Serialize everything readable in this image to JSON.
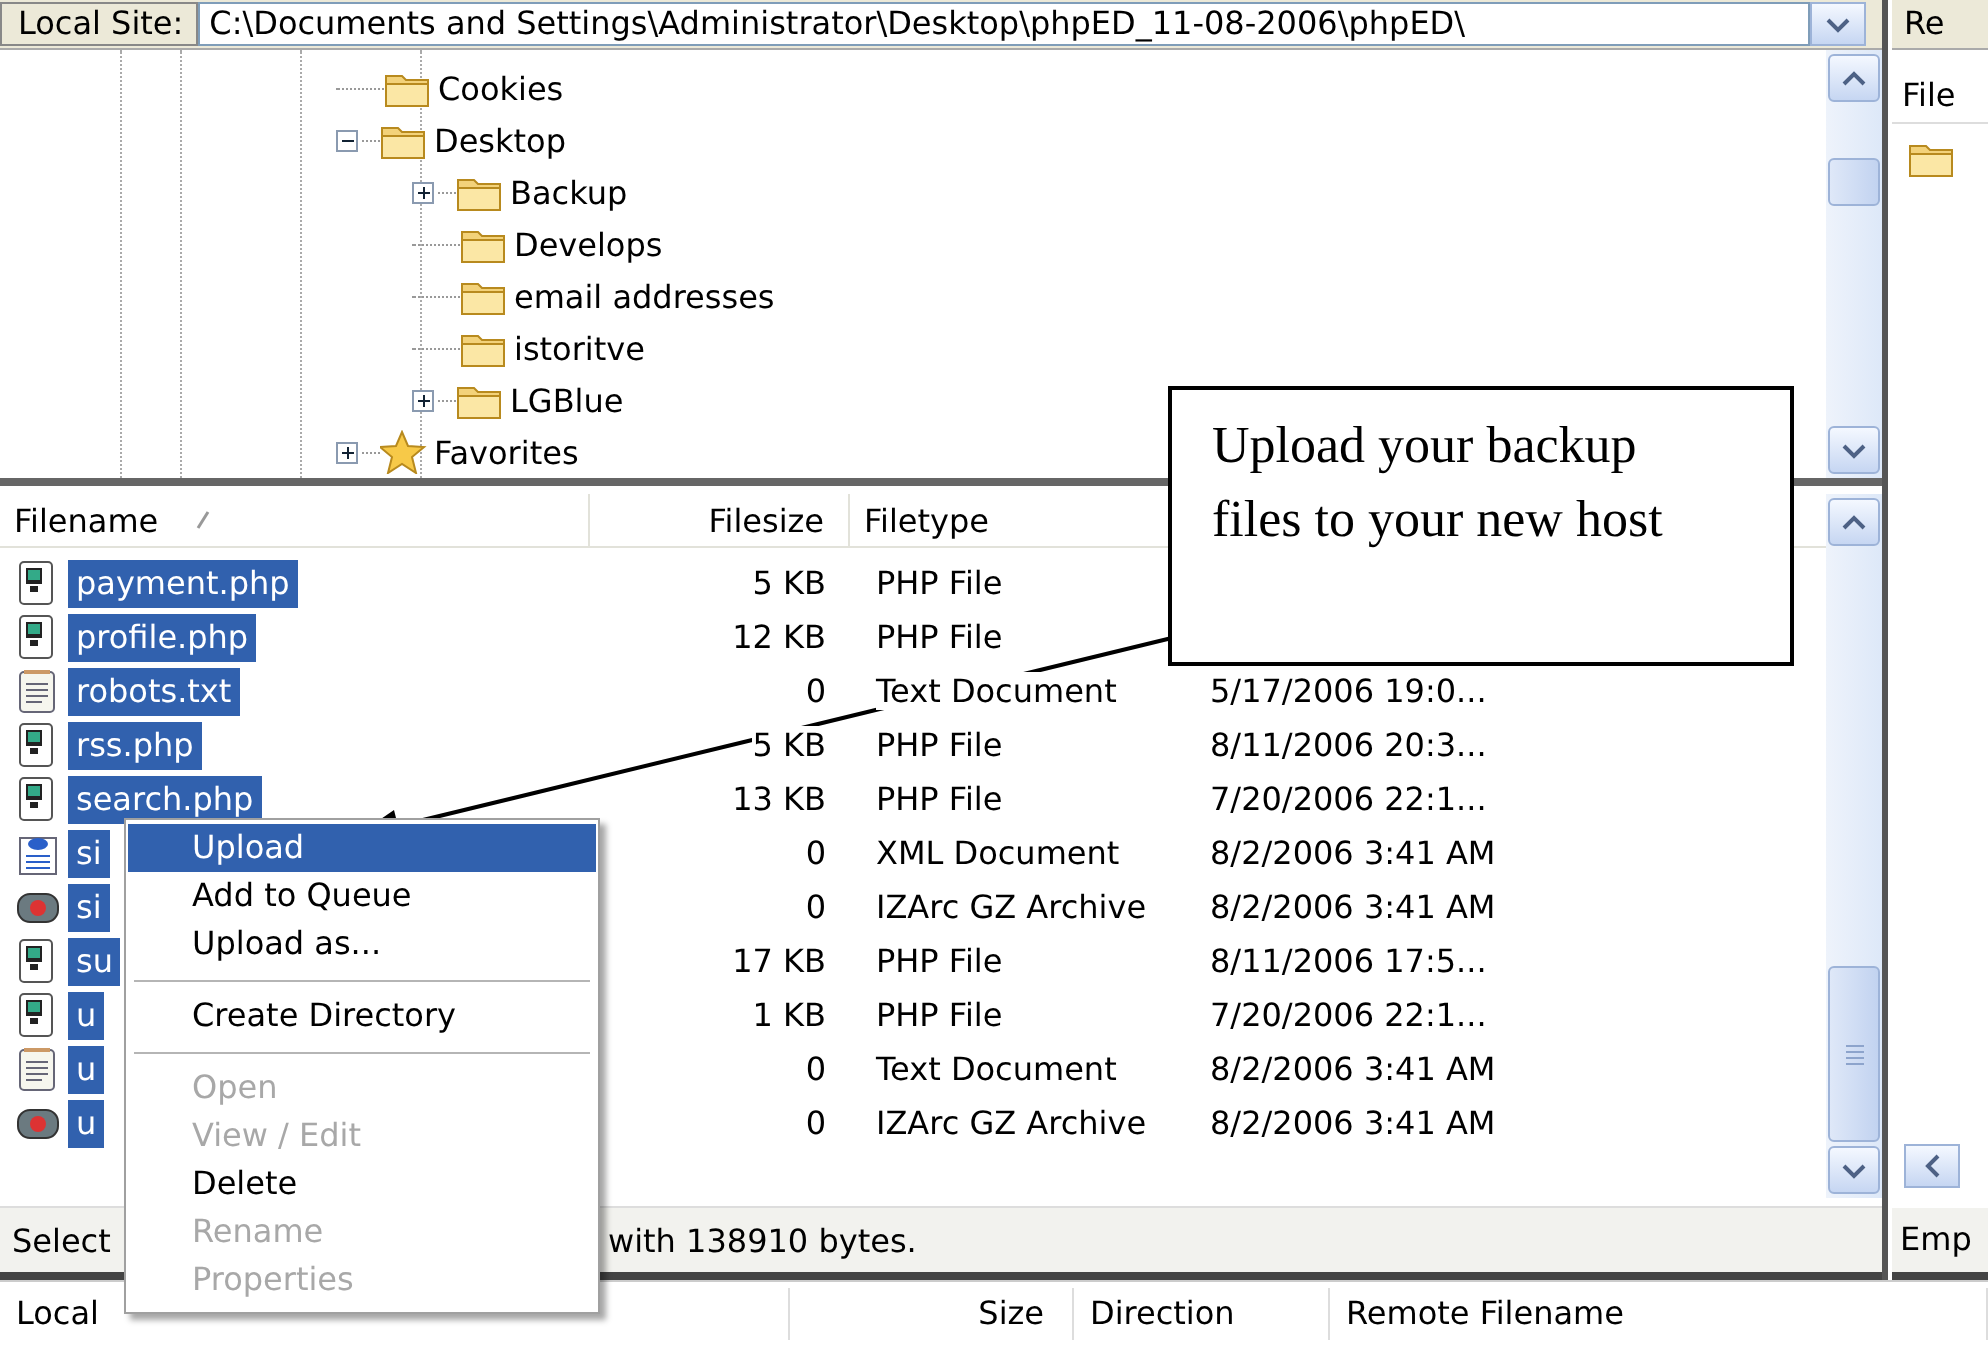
{
  "local_site": {
    "label": "Local Site:",
    "path": "C:\\Documents and Settings\\Administrator\\Desktop\\phpED_11-08-2006\\phpED\\"
  },
  "tree": [
    {
      "kind": "folder",
      "label": "Cookies"
    },
    {
      "kind": "folder",
      "label": "Desktop",
      "expanded": true,
      "children": [
        {
          "kind": "folder",
          "label": "Backup",
          "expanded": false
        },
        {
          "kind": "folder",
          "label": "Develops"
        },
        {
          "kind": "folder",
          "label": "email addresses"
        },
        {
          "kind": "folder",
          "label": "istoritve"
        },
        {
          "kind": "folder",
          "label": "LGBlue",
          "expanded": false
        }
      ]
    },
    {
      "kind": "favorites",
      "label": "Favorites",
      "expanded": false
    }
  ],
  "file_list": {
    "columns": [
      "Filename",
      "Filesize",
      "Filetype"
    ],
    "rows": [
      {
        "kind": "php",
        "name": "payment.php",
        "size": "5 KB",
        "type": "PHP File",
        "selected": true
      },
      {
        "kind": "php",
        "name": "profile.php",
        "size": "12 KB",
        "type": "PHP File",
        "selected": true
      },
      {
        "kind": "txt",
        "name": "robots.txt",
        "size": "0",
        "type": "Text Document",
        "date": "5/17/2006 19:0...",
        "selected": true
      },
      {
        "kind": "php",
        "name": "rss.php",
        "size": "5 KB",
        "type": "PHP File",
        "date": "8/11/2006 20:3...",
        "selected": true
      },
      {
        "kind": "php",
        "name": "search.php",
        "size": "13 KB",
        "type": "PHP File",
        "date": "7/20/2006 22:1...",
        "selected": true
      },
      {
        "kind": "xml",
        "name": "si",
        "size": "0",
        "type": "XML Document",
        "date": "8/2/2006 3:41 AM",
        "selected": true
      },
      {
        "kind": "gz",
        "name": "si",
        "size": "0",
        "type": "IZArc GZ Archive",
        "date": "8/2/2006 3:41 AM",
        "selected": true
      },
      {
        "kind": "php",
        "name": "su",
        "size": "17 KB",
        "type": "PHP File",
        "date": "8/11/2006 17:5...",
        "selected": true
      },
      {
        "kind": "php",
        "name": "u",
        "size": "1 KB",
        "type": "PHP File",
        "date": "7/20/2006 22:1...",
        "selected": true
      },
      {
        "kind": "txt",
        "name": "u",
        "size": "0",
        "type": "Text Document",
        "date": "8/2/2006 3:41 AM",
        "selected": true
      },
      {
        "kind": "gz",
        "name": "u",
        "size": "0",
        "type": "IZArc GZ Archive",
        "date": "8/2/2006 3:41 AM",
        "selected": true
      }
    ]
  },
  "status_bar": {
    "left": "Select",
    "right": "with 138910 bytes."
  },
  "queue": {
    "columns": [
      "Local",
      "Size",
      "Direction",
      "Remote Filename"
    ]
  },
  "remote_pane": {
    "title": "Re",
    "header": "File",
    "status": "Emp"
  },
  "context_menu": [
    {
      "kind": "item",
      "label": "Upload",
      "selected": true,
      "disabled": false
    },
    {
      "kind": "item",
      "label": "Add to Queue",
      "selected": false,
      "disabled": false
    },
    {
      "kind": "item",
      "label": "Upload as...",
      "selected": false,
      "disabled": false
    },
    {
      "kind": "separator"
    },
    {
      "kind": "item",
      "label": "Create Directory",
      "selected": false,
      "disabled": false
    },
    {
      "kind": "separator"
    },
    {
      "kind": "item",
      "label": "Open",
      "selected": false,
      "disabled": true
    },
    {
      "kind": "item",
      "label": "View / Edit",
      "selected": false,
      "disabled": true
    },
    {
      "kind": "item",
      "label": "Delete",
      "selected": false,
      "disabled": false
    },
    {
      "kind": "item",
      "label": "Rename",
      "selected": false,
      "disabled": true
    },
    {
      "kind": "item",
      "label": "Properties",
      "selected": false,
      "disabled": true
    }
  ],
  "callout": {
    "text": "Upload your backup files to your new host"
  }
}
